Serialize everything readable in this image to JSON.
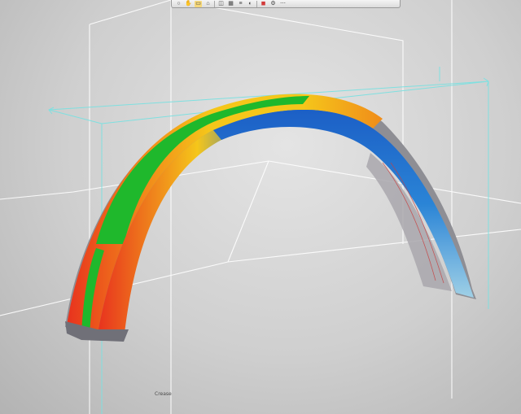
{
  "toolbar": {
    "tools": [
      {
        "name": "orbit-icon",
        "glyph": "○"
      },
      {
        "name": "pan-icon",
        "glyph": "✋"
      },
      {
        "name": "display-mode-icon",
        "glyph": "▭",
        "active": true
      },
      {
        "name": "fit-view-icon",
        "glyph": "⌂"
      },
      {
        "name": "section-icon",
        "glyph": "◫"
      },
      {
        "name": "grid-icon",
        "glyph": "▦"
      },
      {
        "name": "layers-icon",
        "glyph": "≡"
      },
      {
        "name": "analysis-icon",
        "glyph": "◐"
      },
      {
        "name": "render-icon",
        "glyph": "◼",
        "accent": true
      },
      {
        "name": "settings-icon",
        "glyph": "⚙"
      },
      {
        "name": "more-icon",
        "glyph": "⋯"
      }
    ]
  },
  "viewport": {
    "cursor_label": "Crease",
    "colors": {
      "background": "#cfcfcf",
      "grid_lines": "#ffffff",
      "bounding_box": "#7fe0e0",
      "analysis_hot": "#e8321e",
      "analysis_warm": "#f5c61a",
      "analysis_mid": "#1fb82c",
      "analysis_cool": "#1c6fd6",
      "analysis_cold": "#cde3ef"
    }
  }
}
